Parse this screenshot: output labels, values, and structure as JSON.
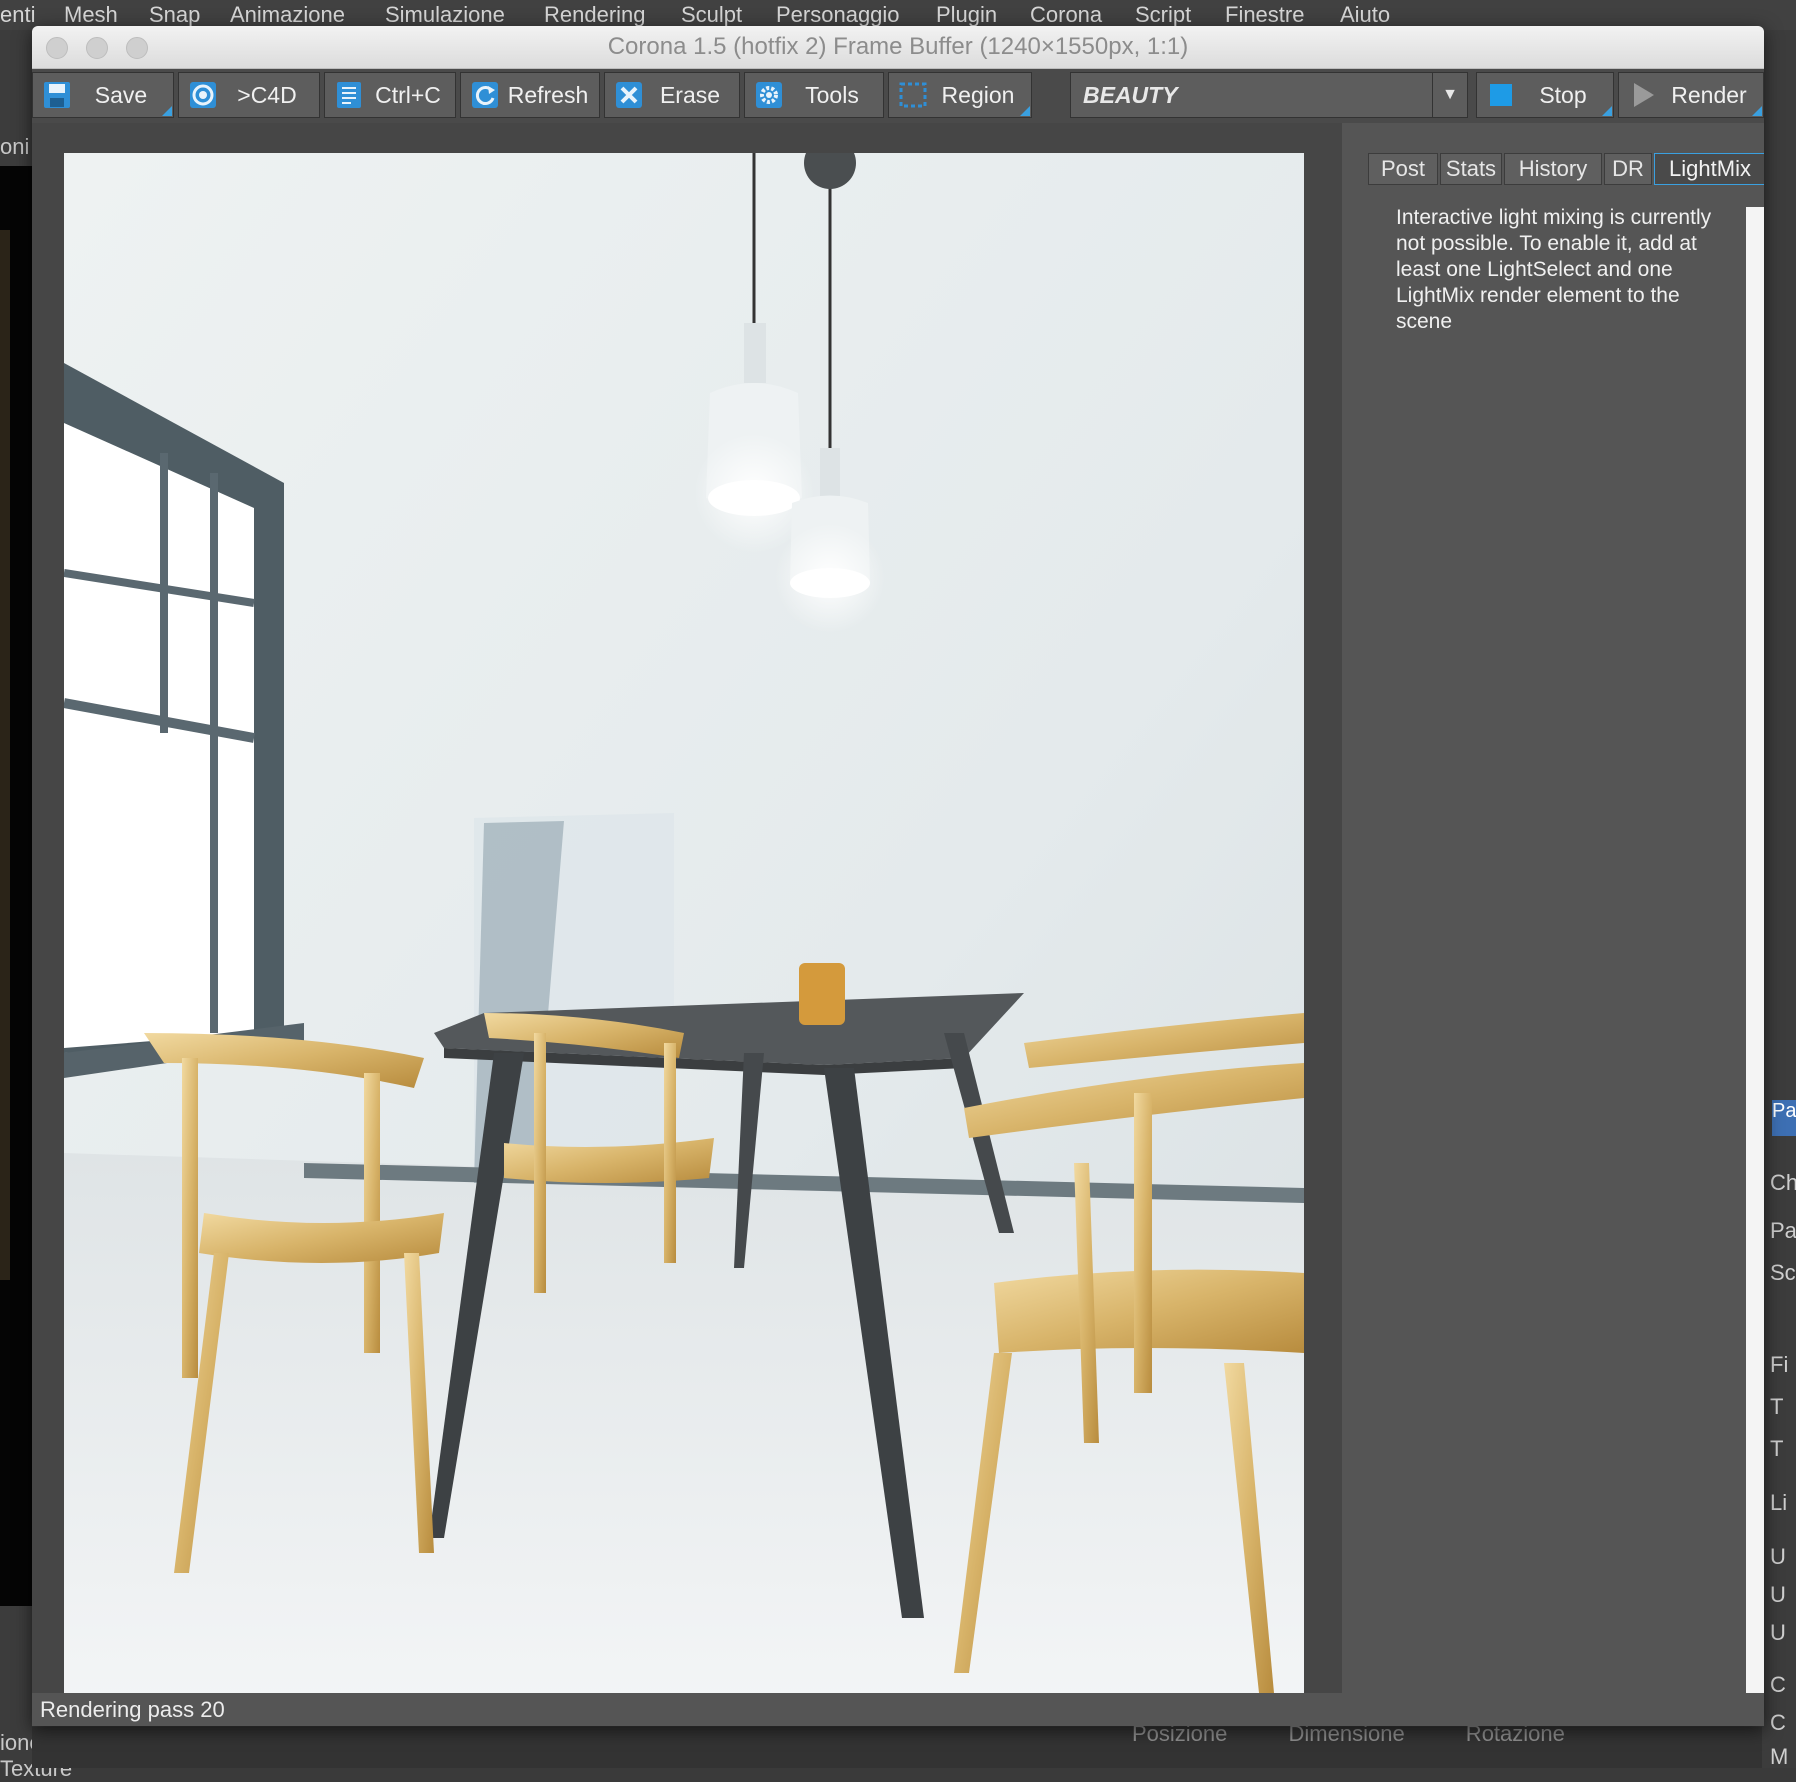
{
  "menubar": {
    "items": [
      "enti",
      "Mesh",
      "Snap",
      "Animazione",
      "Simulazione",
      "Rendering",
      "Sculpt",
      "Personaggio",
      "Plugin",
      "Corona",
      "Script",
      "Finestre",
      "Aiuto"
    ]
  },
  "window": {
    "title": "Corona 1.5 (hotfix 2) Frame Buffer (1240×1550px, 1:1)"
  },
  "toolbar": {
    "save": "Save",
    "to_c4d": ">C4D",
    "ctrl_c": "Ctrl+C",
    "refresh": "Refresh",
    "erase": "Erase",
    "tools": "Tools",
    "region": "Region",
    "channel": "BEAUTY",
    "stop": "Stop",
    "render": "Render"
  },
  "panel": {
    "tabs": [
      "Post",
      "Stats",
      "History",
      "DR",
      "LightMix"
    ],
    "active_tab": "LightMix",
    "message": "Interactive light mixing is currently not possible. To enable it, add at least one LightSelect and one LightMix render element to the scene"
  },
  "status": {
    "text": "Rendering pass 20"
  },
  "background": {
    "left_label": "oni",
    "left_bottom": "ione   Texture",
    "bottom_labels": "Posizione          Dimensione          Rotazione",
    "right_selected": "Pa",
    "right_letters": [
      "Chi",
      "Par",
      "Sc",
      "Fi",
      "T",
      "T",
      "Li",
      "U",
      "U",
      "U",
      "C",
      "C",
      "M"
    ]
  },
  "colors": {
    "accent": "#3aa0e0",
    "panel_bg": "#555555",
    "toolbar_bg": "#4a4a4a",
    "stop_square": "#1e9be6"
  }
}
